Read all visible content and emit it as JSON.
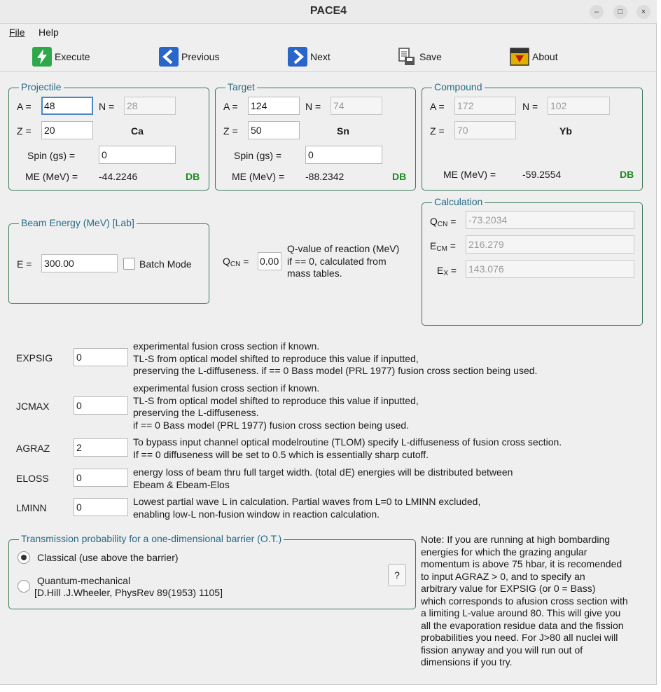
{
  "window": {
    "title": "PACE4",
    "minimize": "–",
    "maximize": "□",
    "close": "×"
  },
  "menu": {
    "file": "File",
    "help": "Help"
  },
  "toolbar": {
    "execute": "Execute",
    "previous": "Previous",
    "next": "Next",
    "save": "Save",
    "about": "About"
  },
  "projectile": {
    "title": "Projectile",
    "a_label": "A =",
    "a": "48",
    "n_label": "N =",
    "n": "28",
    "z_label": "Z =",
    "z": "20",
    "symbol": "Ca",
    "spin_label": "Spin (gs) =",
    "spin": "0",
    "me_label": "ME (MeV) =",
    "me": "-44.2246",
    "db": "DB"
  },
  "target": {
    "title": "Target",
    "a_label": "A =",
    "a": "124",
    "n_label": "N =",
    "n": "74",
    "z_label": "Z =",
    "z": "50",
    "symbol": "Sn",
    "spin_label": "Spin (gs) =",
    "spin": "0",
    "me_label": "ME (MeV) =",
    "me": "-88.2342",
    "db": "DB"
  },
  "compound": {
    "title": "Compound",
    "a_label": "A =",
    "a": "172",
    "n_label": "N =",
    "n": "102",
    "z_label": "Z =",
    "z": "70",
    "symbol": "Yb",
    "me_label": "ME (MeV) =",
    "me": "-59.2554",
    "db": "DB"
  },
  "beam": {
    "title": "Beam Energy (MeV)  [Lab]",
    "e_label": "E =",
    "e": "300.00",
    "batch": "Batch Mode"
  },
  "qvalue": {
    "label_main": "Q",
    "label_sub": "CN",
    "label_eq": " =",
    "value": "0.00",
    "desc1": "Q-value of reaction (MeV)",
    "desc2": "if == 0, calculated from",
    "desc3": "mass tables."
  },
  "calculation": {
    "title": "Calculation",
    "qcn_main": "Q",
    "qcn_sub": "CN",
    "qcn_eq": " =",
    "qcn": "-73.2034",
    "ecm_main": "E",
    "ecm_sub": "CM",
    "ecm_eq": " =",
    "ecm": "216.279",
    "ex_main": "E",
    "ex_sub": "X",
    "ex_eq": " =",
    "ex": "143.076"
  },
  "params": {
    "expsig": {
      "label": "EXPSIG",
      "value": "0",
      "l1": "experimental fusion cross section if known.",
      "l2": "TL-S from optical model shifted to reproduce this value if inputted,",
      "l3": "preserving the L-diffuseness. if == 0 Bass model (PRL 1977) fusion cross section being used."
    },
    "jcmax": {
      "label": "JCMAX",
      "value": "0",
      "l1": "experimental fusion cross section if known.",
      "l2": "TL-S from optical model shifted to reproduce this value if inputted,",
      "l3": "preserving the L-diffuseness.",
      "l4": "if == 0 Bass model (PRL 1977) fusion cross section being used."
    },
    "agraz": {
      "label": "AGRAZ",
      "value": "2",
      "l1": "To bypass input channel optical modelroutine (TLOM) specify L-diffuseness of fusion cross section.",
      "l2": "If == 0 diffuseness will be set to 0.5 which is essentially sharp cutoff."
    },
    "eloss": {
      "label": "ELOSS",
      "value": "0",
      "l1": "energy loss of beam thru full target width. (total dE) energies will be distributed between",
      "l2": "Ebeam & Ebeam-Elos"
    },
    "lminn": {
      "label": "LMINN",
      "value": "0",
      "l1": "Lowest partial wave L in calculation. Partial waves from L=0 to LMINN excluded,",
      "l2": "enabling low-L non-fusion window in reaction calculation."
    }
  },
  "transmission": {
    "title": "Transmission probability for a one-dimensional barrier (O.T.)",
    "classical": "Classical (use above the barrier)",
    "quantum": "Quantum-mechanical",
    "ref": "[D.Hill .J.Wheeler, PhysRev 89(1953) 1105]",
    "help": "?",
    "selected": "classical"
  },
  "note": {
    "l1": "Note: If you are running at high bombarding",
    "l2": "energies for which the grazing angular",
    "l3": "momentum is above 75 hbar, it is recomended",
    "l4": "to input AGRAZ > 0, and to specify an",
    "l5": "arbitrary value for EXPSIG (or 0 = Bass)",
    "l6": "which corresponds to afusion cross section with",
    "l7": "a limiting L-value around 80. This will give you",
    "l8": "all the evaporation residue data and the fission",
    "l9": "probabilities you need. For J>80 all nuclei will",
    "l10": "fission anyway and you will run out of",
    "l11": "dimensions if you try."
  },
  "colors": {
    "frame": "#3b7a57",
    "legend": "#256a86",
    "db": "#1a8a1a",
    "execute_icon": "#2ea84a",
    "nav_icon": "#2a66c8",
    "about_icon": "#e0b000"
  }
}
